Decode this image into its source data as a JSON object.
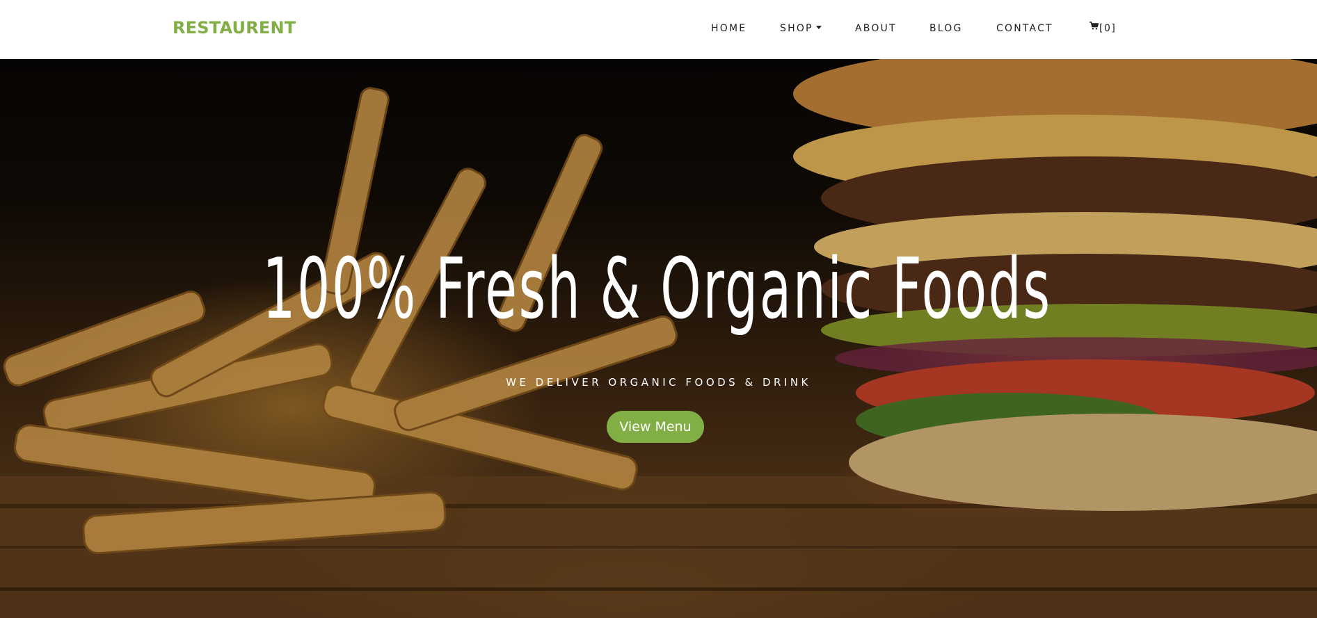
{
  "brand": {
    "name": "RESTAURENT",
    "color": "#82ae46"
  },
  "nav": {
    "items": [
      {
        "label": "HOME"
      },
      {
        "label": "SHOP",
        "has_dropdown": true
      },
      {
        "label": "ABOUT"
      },
      {
        "label": "BLOG"
      },
      {
        "label": "CONTACT"
      }
    ],
    "cart": {
      "icon": "cart-icon",
      "count_label": "[0]"
    }
  },
  "hero": {
    "title": "100% Fresh & Organic Foods",
    "subtitle": "WE DELIVER ORGANIC FOODS & DRINK",
    "cta_label": "View Menu",
    "cta_color": "#82ae46"
  }
}
